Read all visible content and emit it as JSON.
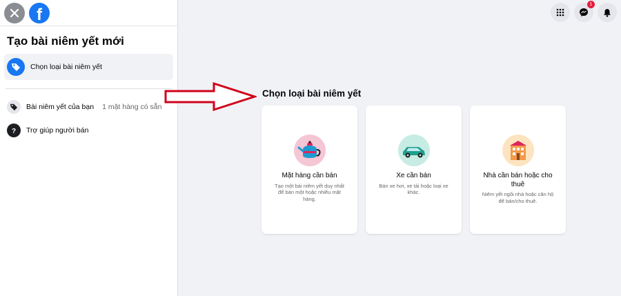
{
  "sidebar": {
    "title": "Tạo bài niêm yết mới",
    "active_item": {
      "label": "Chọn loại bài niêm yết",
      "icon": "tag-icon"
    },
    "items": [
      {
        "label": "Bài niêm yết của bạn",
        "meta": "1 mặt hàng có sẵn",
        "icon": "tags-icon"
      },
      {
        "label": "Trợ giúp người bán",
        "icon": "help-icon"
      }
    ]
  },
  "header": {
    "notification_badge": "1",
    "icons": [
      "menu-grid-icon",
      "messenger-icon",
      "bell-icon"
    ]
  },
  "main": {
    "section_title": "Chọn loại bài niêm yết",
    "cards": [
      {
        "title": "Mặt hàng cần bán",
        "description": "Tạo một bài niêm yết duy nhất để bán một hoặc nhiều mặt hàng.",
        "icon": "teapot-icon",
        "color": "#f5c6d4"
      },
      {
        "title": "Xe cần bán",
        "description": "Bán xe hơi, xe tải hoặc loại xe khác.",
        "icon": "car-icon",
        "color": "#c7ece4"
      },
      {
        "title": "Nhà cần bán hoặc cho thuê",
        "description": "Niêm yết ngôi nhà hoặc căn hộ để bán/cho thuê.",
        "icon": "house-icon",
        "color": "#fde4c0"
      }
    ]
  },
  "colors": {
    "accent": "#1877f2",
    "arrow": "#d0021b",
    "background": "#f0f2f5"
  }
}
